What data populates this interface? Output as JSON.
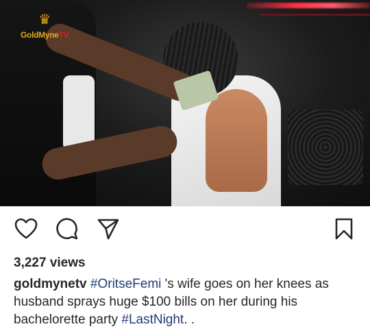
{
  "post": {
    "logo_brand": "GoldMyne",
    "logo_tv": "TV",
    "views": "3,227 views",
    "username": "goldmynetv",
    "caption_parts": [
      {
        "type": "tag",
        "text": "#OritseFemi"
      },
      {
        "type": "text",
        "text": " 's wife goes on her knees as husband sprays huge $100 bills on her during his bachelorette party "
      },
      {
        "type": "tag",
        "text": "#LastNight"
      },
      {
        "type": "text",
        "text": ". ."
      }
    ]
  },
  "icons": {
    "like": "heart-icon",
    "comment": "comment-icon",
    "share": "send-icon",
    "save": "bookmark-icon"
  },
  "colors": {
    "text": "#262626",
    "hashtag": "#1f3a73",
    "logo_gold": "#e8a81c",
    "logo_red": "#d92020"
  }
}
